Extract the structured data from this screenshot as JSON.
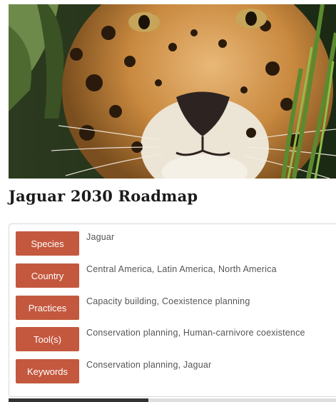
{
  "page": {
    "title": "Jaguar 2030 Roadmap",
    "hero_icon": "jaguar-photo"
  },
  "details": [
    {
      "label": "Species",
      "value": "Jaguar"
    },
    {
      "label": "Country",
      "value": "Central America, Latin America, North America"
    },
    {
      "label": "Practices",
      "value": "Capacity building, Coexistence planning"
    },
    {
      "label": "Tool(s)",
      "value": "Conservation planning, Human-carnivore coexistence"
    },
    {
      "label": "Keywords",
      "value": "Conservation planning, Jaguar"
    }
  ],
  "colors": {
    "tag_background": "#c4583e",
    "tag_text": "#ffffff",
    "value_text": "#555555",
    "title_text": "#1b1b1b"
  }
}
